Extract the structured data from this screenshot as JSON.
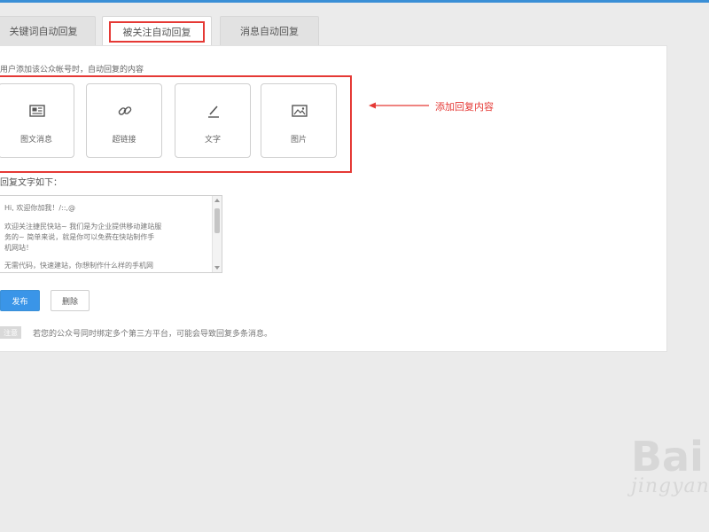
{
  "tabs": [
    {
      "label": "关键词自动回复"
    },
    {
      "label": "被关注自动回复"
    },
    {
      "label": "消息自动回复"
    }
  ],
  "content": {
    "description": "用户添加该公众帐号时，自动回复的内容",
    "reply_types": [
      {
        "label": "图文消息",
        "icon": "news-icon"
      },
      {
        "label": "超链接",
        "icon": "link-icon"
      },
      {
        "label": "文字",
        "icon": "pencil-icon"
      },
      {
        "label": "图片",
        "icon": "image-icon"
      }
    ],
    "annotation": "添加回复内容",
    "reply_label": "回复文字如下：",
    "reply_text": {
      "lines": [
        "Hi, 欢迎你加我！/::,@",
        "欢迎关注捷民快站~ 我们是为企业提供移动建站服",
        "务的~ 简单来说，就是你可以免费在快站制作手",
        "机网站！",
        "无需代码，快速建站，你想制作什么样的手机网"
      ]
    },
    "buttons": {
      "publish": "发布",
      "delete": "删除"
    },
    "notice": {
      "badge": "注意",
      "text": "若您的公众号同时绑定多个第三方平台，可能会导致回复多条消息。"
    }
  },
  "watermark": {
    "main": "Bai",
    "sub": "jingyan"
  },
  "colors": {
    "accent": "#3a95e8",
    "highlight": "#e53935"
  }
}
